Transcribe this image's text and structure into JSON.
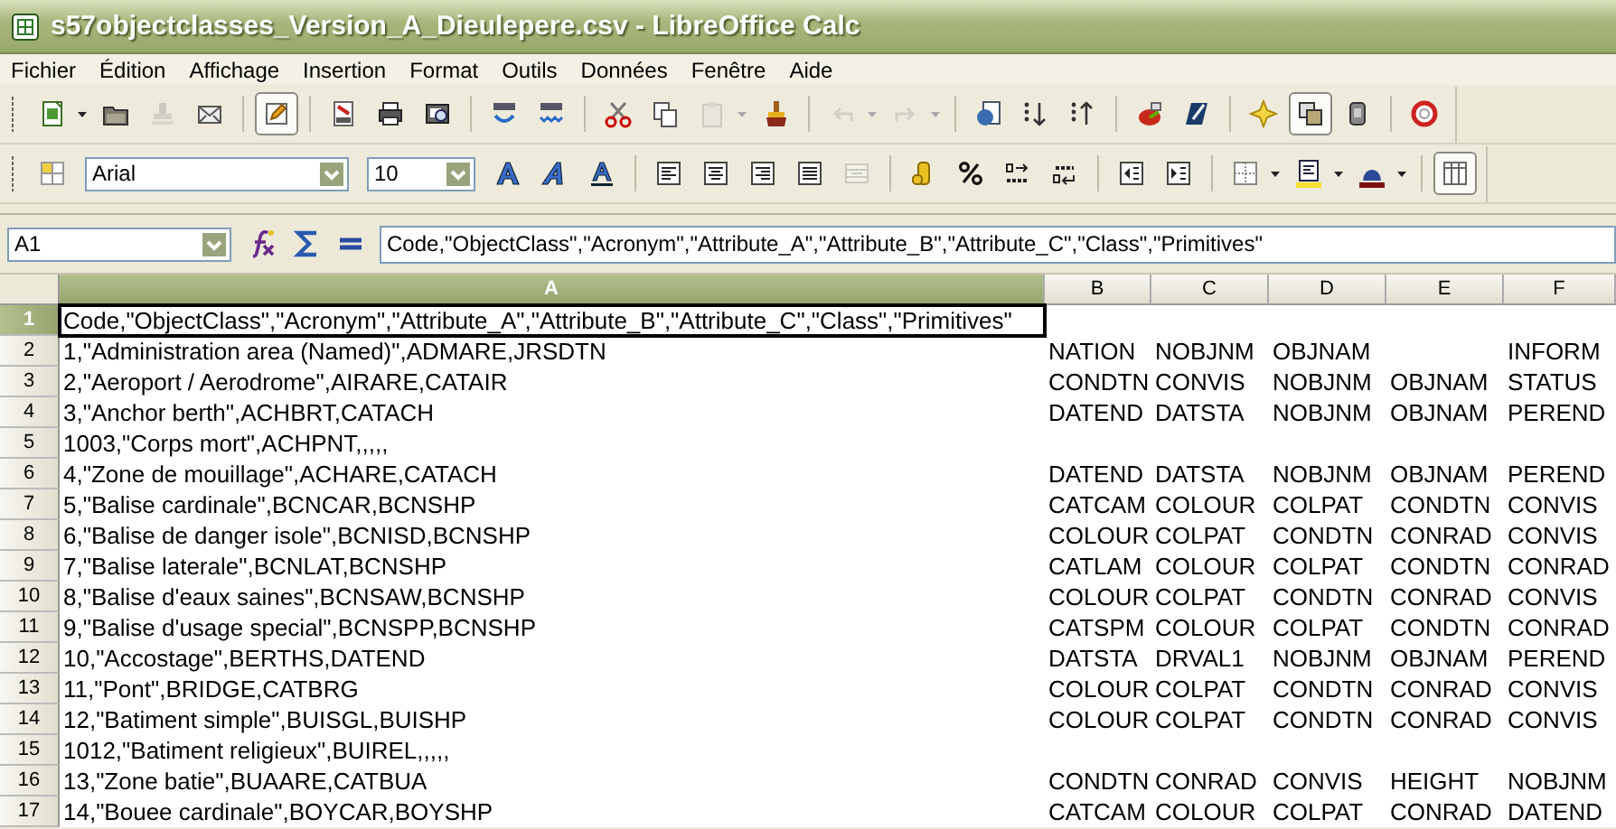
{
  "window": {
    "title": "s57objectclasses_Version_A_Dieulepere.csv - LibreOffice Calc"
  },
  "menu": [
    "Fichier",
    "Édition",
    "Affichage",
    "Insertion",
    "Format",
    "Outils",
    "Données",
    "Fenêtre",
    "Aide"
  ],
  "standard_toolbar": [
    {
      "pressed": false,
      "disabled": false
    },
    {
      "pressed": false,
      "disabled": false
    },
    {
      "pressed": false,
      "disabled": true
    },
    {
      "pressed": false,
      "disabled": false
    },
    {
      "pressed": true,
      "disabled": false
    },
    {
      "pressed": false,
      "disabled": false
    },
    {
      "pressed": false,
      "disabled": false
    },
    {
      "pressed": false,
      "disabled": false
    },
    {
      "pressed": false,
      "disabled": false
    },
    {
      "pressed": false,
      "disabled": false
    },
    {
      "pressed": false,
      "disabled": false
    },
    {
      "pressed": false,
      "disabled": false
    },
    {
      "pressed": false,
      "disabled": true
    },
    {
      "pressed": false,
      "disabled": false
    },
    {
      "pressed": false,
      "disabled": true
    },
    {
      "pressed": false,
      "disabled": true
    },
    {
      "pressed": false,
      "disabled": false
    },
    {
      "pressed": false,
      "disabled": false
    },
    {
      "pressed": false,
      "disabled": false
    },
    {
      "pressed": false,
      "disabled": false
    },
    {
      "pressed": false,
      "disabled": false
    },
    {
      "pressed": false,
      "disabled": false
    },
    {
      "pressed": true,
      "disabled": false
    },
    {
      "pressed": false,
      "disabled": false
    },
    {
      "pressed": false,
      "disabled": false
    }
  ],
  "formatting_toolbar": {
    "font_name": "Arial",
    "font_size": "10",
    "buttons": [
      {
        "pressed": false,
        "disabled": false
      },
      {
        "pressed": false,
        "disabled": false
      },
      {
        "pressed": false,
        "disabled": false
      },
      {
        "pressed": false,
        "disabled": false
      },
      {
        "pressed": false,
        "disabled": false
      },
      {
        "pressed": false,
        "disabled": false
      },
      {
        "pressed": false,
        "disabled": false
      },
      {
        "pressed": false,
        "disabled": false
      },
      {
        "pressed": false,
        "disabled": true
      },
      {
        "pressed": false,
        "disabled": false
      },
      {
        "pressed": false,
        "disabled": false
      },
      {
        "pressed": false,
        "disabled": false
      },
      {
        "pressed": false,
        "disabled": false
      },
      {
        "pressed": false,
        "disabled": false
      },
      {
        "pressed": false,
        "disabled": false
      },
      {
        "pressed": false,
        "disabled": false
      },
      {
        "pressed": false,
        "disabled": false
      },
      {
        "pressed": false,
        "disabled": false
      },
      {
        "pressed": true,
        "disabled": false
      }
    ]
  },
  "formula_bar": {
    "name_box": "A1",
    "formula": "Code,\"ObjectClass\",\"Acronym\",\"Attribute_A\",\"Attribute_B\",\"Attribute_C\",\"Class\",\"Primitives\""
  },
  "sheet": {
    "columns": [
      {
        "label": "A",
        "selected": true
      },
      {
        "label": "B",
        "selected": false
      },
      {
        "label": "C",
        "selected": false
      },
      {
        "label": "D",
        "selected": false
      },
      {
        "label": "E",
        "selected": false
      },
      {
        "label": "F",
        "selected": false
      }
    ],
    "rows": [
      {
        "header": "1",
        "selected": true,
        "cells": [
          "Code,\"ObjectClass\",\"Acronym\",\"Attribute_A\",\"Attribute_B\",\"Attribute_C\",\"Class\",\"Primitives\"",
          null,
          null,
          null,
          null,
          null
        ]
      },
      {
        "header": "2",
        "selected": false,
        "cells": [
          "1,\"Administration area (Named)\",ADMARE,JRSDTN",
          "NATION",
          "NOBJNM",
          "OBJNAM",
          null,
          "INFORM"
        ]
      },
      {
        "header": "3",
        "selected": false,
        "cells": [
          "2,\"Aeroport / Aerodrome\",AIRARE,CATAIR",
          "CONDTN",
          "CONVIS",
          "NOBJNM",
          "OBJNAM",
          "STATUS"
        ]
      },
      {
        "header": "4",
        "selected": false,
        "cells": [
          "3,\"Anchor berth\",ACHBRT,CATACH",
          "DATEND",
          "DATSTA",
          "NOBJNM",
          "OBJNAM",
          "PEREND"
        ]
      },
      {
        "header": "5",
        "selected": false,
        "cells": [
          "1003,\"Corps mort\",ACHPNT,,,,,",
          null,
          null,
          null,
          null,
          null
        ]
      },
      {
        "header": "6",
        "selected": false,
        "cells": [
          "4,\"Zone de mouillage\",ACHARE,CATACH",
          "DATEND",
          "DATSTA",
          "NOBJNM",
          "OBJNAM",
          "PEREND"
        ]
      },
      {
        "header": "7",
        "selected": false,
        "cells": [
          "5,\"Balise cardinale\",BCNCAR,BCNSHP",
          "CATCAM",
          "COLOUR",
          "COLPAT",
          "CONDTN",
          "CONVIS"
        ]
      },
      {
        "header": "8",
        "selected": false,
        "cells": [
          "6,\"Balise de danger isole\",BCNISD,BCNSHP",
          "COLOUR",
          "COLPAT",
          "CONDTN",
          "CONRAD",
          "CONVIS"
        ]
      },
      {
        "header": "9",
        "selected": false,
        "cells": [
          "7,\"Balise laterale\",BCNLAT,BCNSHP",
          "CATLAM",
          "COLOUR",
          "COLPAT",
          "CONDTN",
          "CONRAD"
        ]
      },
      {
        "header": "10",
        "selected": false,
        "cells": [
          "8,\"Balise d'eaux saines\",BCNSAW,BCNSHP",
          "COLOUR",
          "COLPAT",
          "CONDTN",
          "CONRAD",
          "CONVIS"
        ]
      },
      {
        "header": "11",
        "selected": false,
        "cells": [
          "9,\"Balise d'usage special\",BCNSPP,BCNSHP",
          "CATSPM",
          "COLOUR",
          "COLPAT",
          "CONDTN",
          "CONRAD"
        ]
      },
      {
        "header": "12",
        "selected": false,
        "cells": [
          "10,\"Accostage\",BERTHS,DATEND",
          "DATSTA",
          "DRVAL1",
          "NOBJNM",
          "OBJNAM",
          "PEREND"
        ]
      },
      {
        "header": "13",
        "selected": false,
        "cells": [
          "11,\"Pont\",BRIDGE,CATBRG",
          "COLOUR",
          "COLPAT",
          "CONDTN",
          "CONRAD",
          "CONVIS"
        ]
      },
      {
        "header": "14",
        "selected": false,
        "cells": [
          "12,\"Batiment simple\",BUISGL,BUISHP",
          "COLOUR",
          "COLPAT",
          "CONDTN",
          "CONRAD",
          "CONVIS"
        ]
      },
      {
        "header": "15",
        "selected": false,
        "cells": [
          "1012,\"Batiment religieux\",BUIREL,,,,,",
          null,
          null,
          null,
          null,
          null
        ]
      },
      {
        "header": "16",
        "selected": false,
        "cells": [
          "13,\"Zone batie\",BUAARE,CATBUA",
          "CONDTN",
          "CONRAD",
          "CONVIS",
          "HEIGHT",
          "NOBJNM"
        ]
      },
      {
        "header": "17",
        "selected": false,
        "cells": [
          "14,\"Bouee cardinale\",BOYCAR,BOYSHP",
          "CATCAM",
          "COLOUR",
          "COLPAT",
          "CONRAD",
          "DATEND"
        ]
      }
    ]
  }
}
